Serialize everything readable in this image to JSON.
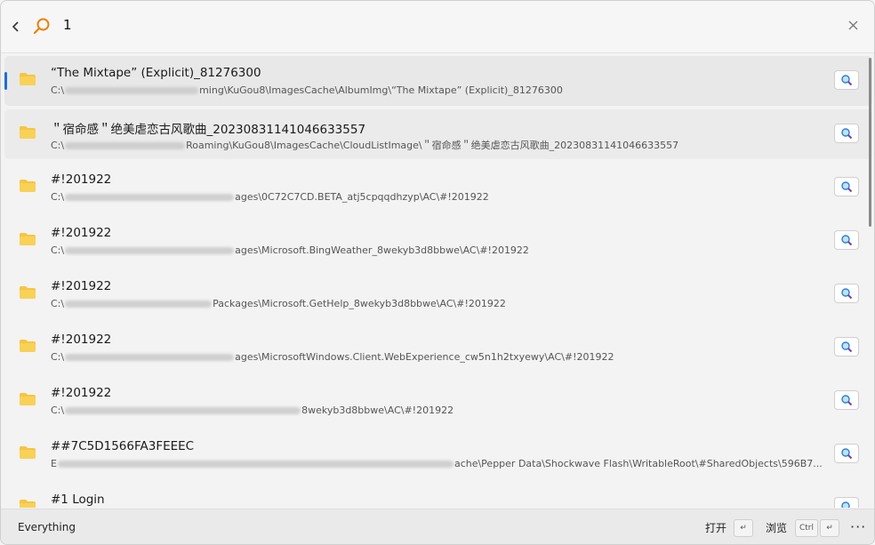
{
  "search": {
    "query": "1"
  },
  "icons": {
    "back": "chevron-left-icon",
    "search": "search-icon",
    "close": "close-icon",
    "folder": "folder-icon",
    "preview": "magnifier-preview-icon"
  },
  "colors": {
    "accent": "#1f6fd1",
    "search_icon": "#e8820c",
    "folder": "#f5c542"
  },
  "results": [
    {
      "title": "“The Mixtape” (Explicit)_81276300",
      "path_start": "C:\\",
      "path_end": "ming\\KuGou8\\ImagesCache\\AlbumImg\\“The Mixtape” (Explicit)_81276300"
    },
    {
      "title": "＂宿命感＂绝美虐恋古风歌曲_20230831141046633557",
      "path_start": "C:\\",
      "path_end": "Roaming\\KuGou8\\ImagesCache\\CloudListImage\\＂宿命感＂绝美虐恋古风歌曲_20230831141046633557"
    },
    {
      "title": "#!201922",
      "path_start": "C:\\",
      "path_end": "ages\\0C72C7CD.BETA_atj5cpqqdhzyp\\AC\\#!201922"
    },
    {
      "title": "#!201922",
      "path_start": "C:\\",
      "path_end": "ages\\Microsoft.BingWeather_8wekyb3d8bbwe\\AC\\#!201922"
    },
    {
      "title": "#!201922",
      "path_start": "C:\\",
      "path_end": "Packages\\Microsoft.GetHelp_8wekyb3d8bbwe\\AC\\#!201922"
    },
    {
      "title": "#!201922",
      "path_start": "C:\\",
      "path_end": "ages\\MicrosoftWindows.Client.WebExperience_cw5n1h2txyewy\\AC\\#!201922"
    },
    {
      "title": "#!201922",
      "path_start": "C:\\",
      "path_end": "8wekyb3d8bbwe\\AC\\#!201922"
    },
    {
      "title": "##7C5D1566FA3FEEEC",
      "path_start": "E",
      "path_end": "ache\\Pepper Data\\Shockwave Flash\\WritableRoot\\#SharedObjects\\596B7..."
    },
    {
      "title": "#1 Login",
      "path_start": "",
      "path_end": ""
    }
  ],
  "footer": {
    "source": "Everything",
    "open_label": "打开",
    "browse_label": "浏览",
    "ctrl_key": "Ctrl",
    "enter_key": "↵",
    "more": "···"
  }
}
